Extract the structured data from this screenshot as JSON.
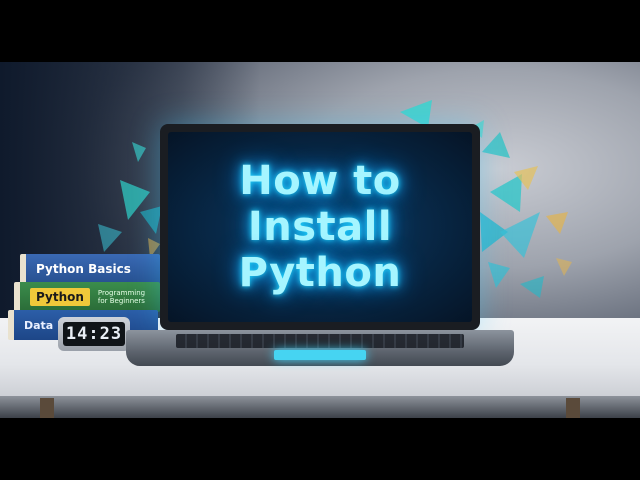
{
  "thumbnail": {
    "headline_line1": "How to Install",
    "headline_line2": "Python"
  },
  "books": {
    "top_title": "Python Basics",
    "middle_badge": "Python",
    "middle_subtitle_line1": "Programming",
    "middle_subtitle_line2": "for Beginners",
    "bottom_title": "Data Essentials"
  },
  "clock": {
    "time": "14:23"
  },
  "colors": {
    "glow_cyan": "#20d8ff",
    "headline_text": "#a6f5ff",
    "book_blue": "#3a69b4",
    "book_green": "#3b8d4c"
  }
}
